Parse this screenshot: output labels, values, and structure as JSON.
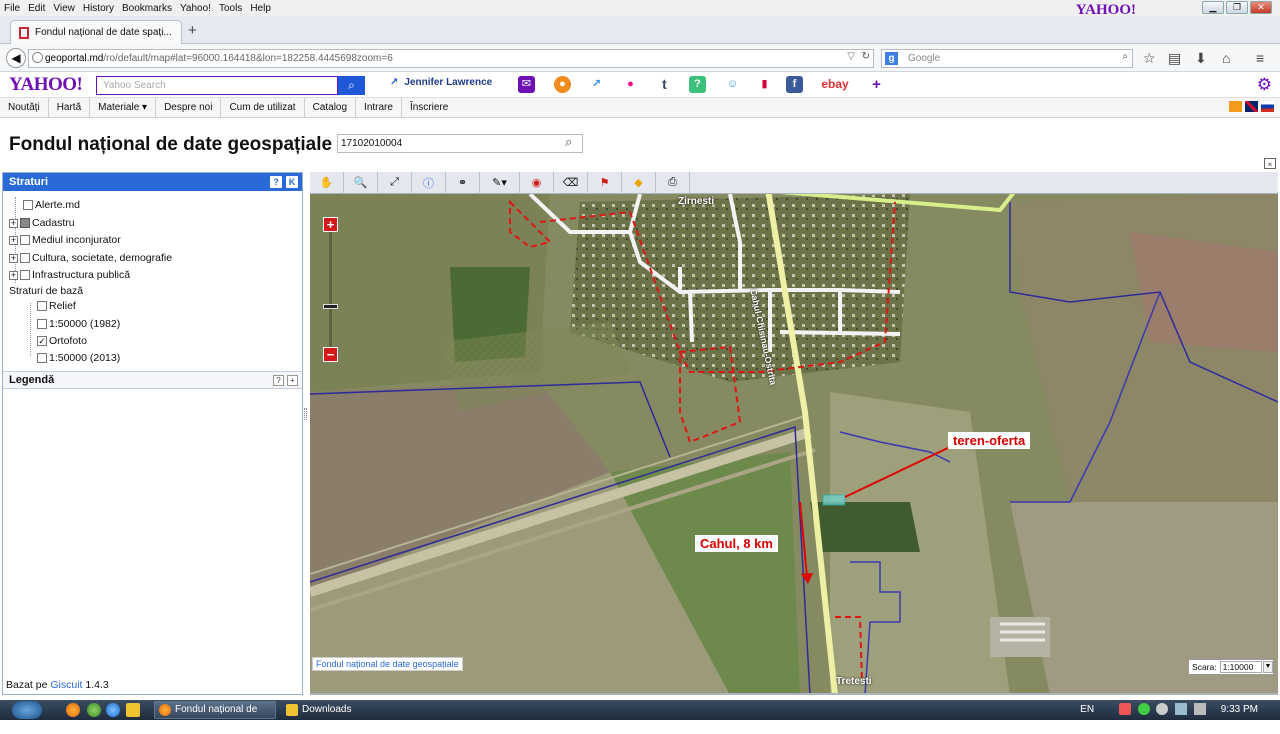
{
  "browser": {
    "menu": [
      "File",
      "Edit",
      "View",
      "History",
      "Bookmarks",
      "Yahoo!",
      "Tools",
      "Help"
    ],
    "brand": "YAHOO!",
    "tab_title": "Fondul național de date spați...",
    "new_tab": "+",
    "url_host": "geoportal.md",
    "url_rest": "/ro/default/map#lat=96000.164418&lon=182258.4445698zoom=6",
    "search_engine_placeholder": "Google"
  },
  "yahoo_toolbar": {
    "logo": "YAHOO!",
    "search_placeholder": "Yahoo Search",
    "trending": "Jennifer Lawrence",
    "ebay": "ebay"
  },
  "site_nav": {
    "items": [
      "Noutăți",
      "Hartă",
      "Materiale ▾",
      "Despre noi",
      "Cum de utilizat",
      "Catalog",
      "Intrare",
      "Înscriere"
    ]
  },
  "header": {
    "title": "Fondul național de date geospațiale",
    "search_value": "17102010004"
  },
  "layers_panel": {
    "title": "Straturi",
    "help": "?",
    "collapse": "K",
    "items": [
      {
        "label": "Alerte.md"
      },
      {
        "label": "Cadastru"
      },
      {
        "label": "Mediul inconjurator"
      },
      {
        "label": "Cultura, societate, demografie"
      },
      {
        "label": "Infrastructura publică"
      }
    ],
    "base_title": "Straturi de bază",
    "base_items": [
      {
        "label": "Relief",
        "checked": false
      },
      {
        "label": "1:50000 (1982)",
        "checked": false
      },
      {
        "label": "Ortofoto",
        "checked": true
      },
      {
        "label": "1:50000 (2013)",
        "checked": false
      }
    ],
    "legend_title": "Legendă",
    "legend_help": "?",
    "legend_expand": "+",
    "footer_prefix": "Bazat pe",
    "footer_link": "Giscuit",
    "footer_version": "1.4.3"
  },
  "map": {
    "zoom_in": "+",
    "zoom_out": "−",
    "zoom_level": 0.37,
    "labels": {
      "village_top": "Zirnesti",
      "road": "Cahul-Chisinau-Ostrita",
      "village_bottom": "Tretesti"
    },
    "callout_offer": "teren-oferta",
    "callout_cahul": "Cahul, 8 km",
    "credit": "Fondul național de date geospațiale",
    "scale_label": "Scara:",
    "scale_value": "1:10000"
  },
  "taskbar": {
    "task1": "Fondul național de da...",
    "task2": "Downloads",
    "lang": "EN",
    "time": "9:33 PM"
  },
  "colors": {
    "yahoo_purple": "#6f10b5",
    "panel_blue": "#2a6ad7",
    "callout_red": "#d40000"
  }
}
